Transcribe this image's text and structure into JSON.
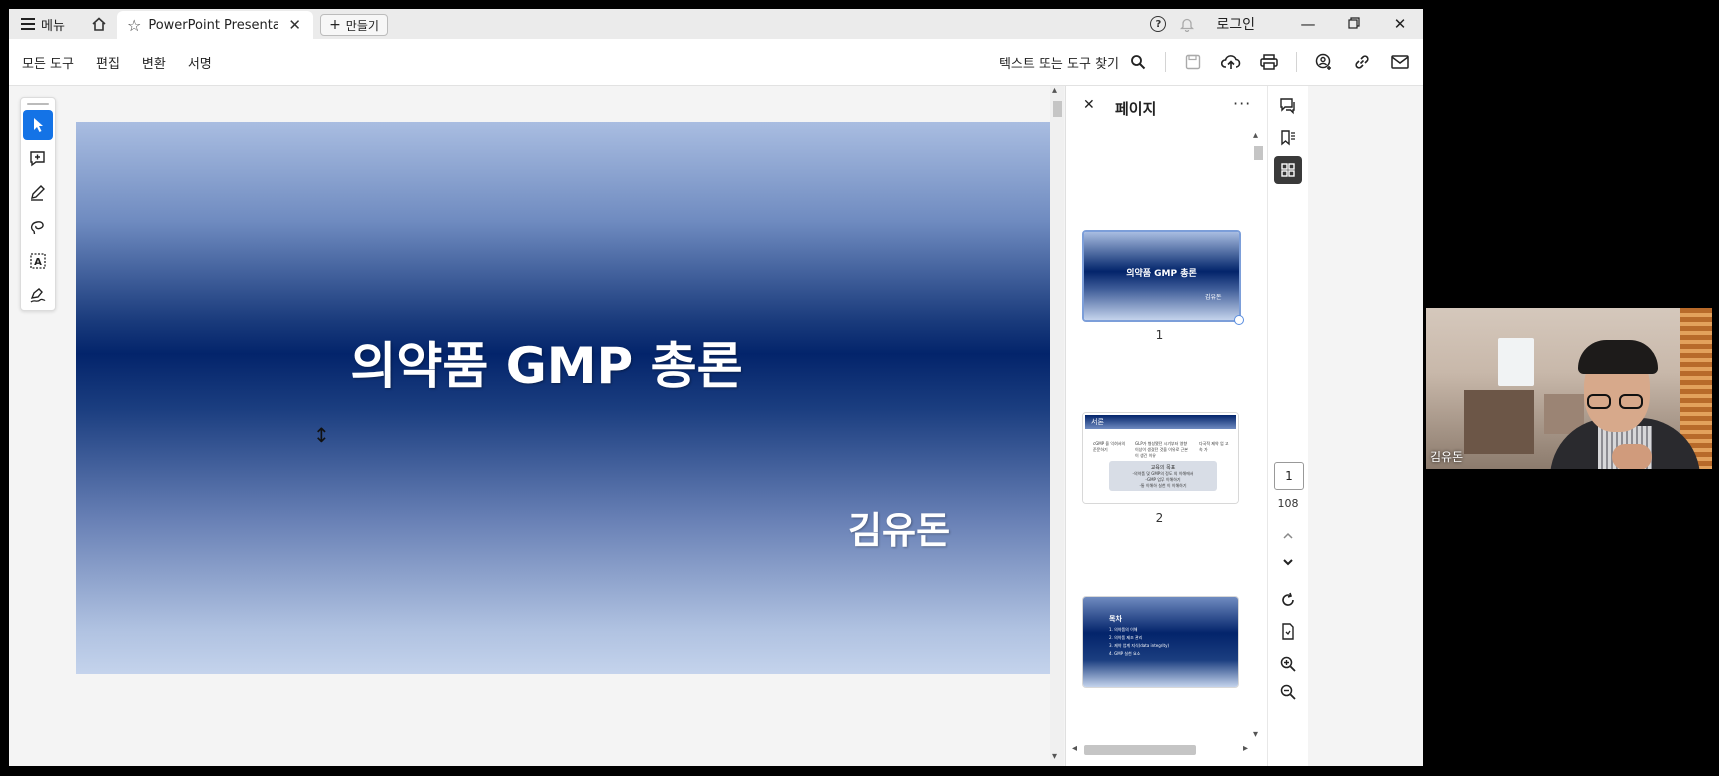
{
  "titlebar": {
    "menu_label": "메뉴",
    "tab_title": "PowerPoint Presentat...",
    "new_tab_label": "만들기",
    "login_label": "로그인"
  },
  "toolbar": {
    "menu_items": [
      "모든 도구",
      "편집",
      "변환",
      "서명"
    ],
    "find_label": "텍스트 또는 도구 찾기"
  },
  "slide": {
    "title": "의약품 GMP 총론",
    "author": "김유돈"
  },
  "pages_panel": {
    "title": "페이지",
    "thumbnails": [
      {
        "page": "1",
        "title": "의약품 GMP 총론",
        "author": "김유돈"
      },
      {
        "page": "2",
        "header": "서론",
        "left_text": "cGMP 을 익혀서의 준문하기",
        "mid_text": "GLP가 형성됐던 시기부터 영향 이상이 생겼던 것을 이유로 근본 이 생긴 이유",
        "right_text": "다국적 제약 업 고 속 가",
        "box_title": "교육의 목표",
        "box_lines": [
          "-의약품 및 GMP의 정도 의 이해에서",
          "-GMP 업무 이해하기",
          "-통 이해하 실천 이 이해하기"
        ]
      },
      {
        "page": "",
        "heading": "목차",
        "items": [
          "1. 의약품의 이해",
          "2. 의약품 제조 관리",
          "3. 제약 업계 지식(data integrity)",
          "4. GMP 실천 요소"
        ]
      }
    ]
  },
  "navigation": {
    "current_page": "1",
    "total_pages": "108"
  },
  "webcam": {
    "name": "김유돈"
  },
  "colors": {
    "accent": "#1473e6",
    "slide_dark": "#03246b",
    "slide_light": "#c4d3ec"
  }
}
